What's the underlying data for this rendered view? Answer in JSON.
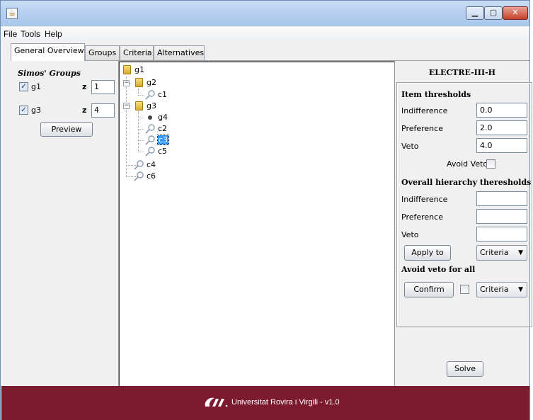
{
  "window": {
    "icon": "java-cup-icon",
    "controls": {
      "minimize": "▁",
      "maximize": "▢",
      "close": "✕"
    }
  },
  "menubar": {
    "items": [
      "File",
      "Tools",
      "Help"
    ]
  },
  "tabs": [
    {
      "label": "General Overview",
      "active": true
    },
    {
      "label": "Groups",
      "active": false
    },
    {
      "label": "Criteria",
      "active": false
    },
    {
      "label": "Alternatives",
      "active": false
    }
  ],
  "groups_panel": {
    "title": "Simos' Groups",
    "rows": [
      {
        "name": "g1",
        "checked": true,
        "z_label": "z",
        "z_value": "1"
      },
      {
        "name": "g3",
        "checked": true,
        "z_label": "z",
        "z_value": "4"
      }
    ],
    "preview_label": "Preview"
  },
  "tree": {
    "nodes": [
      {
        "label": "g1",
        "icon": "folder-icon",
        "level": 0
      },
      {
        "label": "g2",
        "icon": "folder-icon",
        "level": 1,
        "expanded": true
      },
      {
        "label": "c1",
        "icon": "magnifier-icon",
        "level": 2
      },
      {
        "label": "g3",
        "icon": "folder-icon",
        "level": 1,
        "expanded": true
      },
      {
        "label": "g4",
        "icon": "bullet-icon",
        "level": 2
      },
      {
        "label": "c2",
        "icon": "magnifier-icon",
        "level": 2
      },
      {
        "label": "c3",
        "icon": "magnifier-icon",
        "level": 2,
        "selected": true
      },
      {
        "label": "c5",
        "icon": "magnifier-icon",
        "level": 2
      },
      {
        "label": "c4",
        "icon": "magnifier-icon",
        "level": 1
      },
      {
        "label": "c6",
        "icon": "magnifier-icon",
        "level": 1
      }
    ]
  },
  "electre": {
    "title": "ELECTRE-III-H",
    "item_thresholds_title": "Item thresholds",
    "item": {
      "indifference_label": "Indifference",
      "indifference_value": "0.0",
      "preference_label": "Preference",
      "preference_value": "2.0",
      "veto_label": "Veto",
      "veto_value": "4.0",
      "avoid_veto_label": "Avoid Veto"
    },
    "overall_title": "Overall hierarchy theresholds",
    "overall": {
      "indifference_label": "Indifference",
      "indifference_value": "",
      "preference_label": "Preference",
      "preference_value": "",
      "veto_label": "Veto",
      "veto_value": ""
    },
    "apply_label": "Apply to",
    "apply_combo_value": "Criteria",
    "avoid_veto_all_title": "Avoid veto for all",
    "confirm_label": "Confirm",
    "confirm_combo_value": "Criteria",
    "solve_label": "Solve"
  },
  "footer": {
    "text": "Universitat Rovira i Virgili - v1.0",
    "logo": "urv-logo-icon",
    "background": "#7c1a30"
  }
}
